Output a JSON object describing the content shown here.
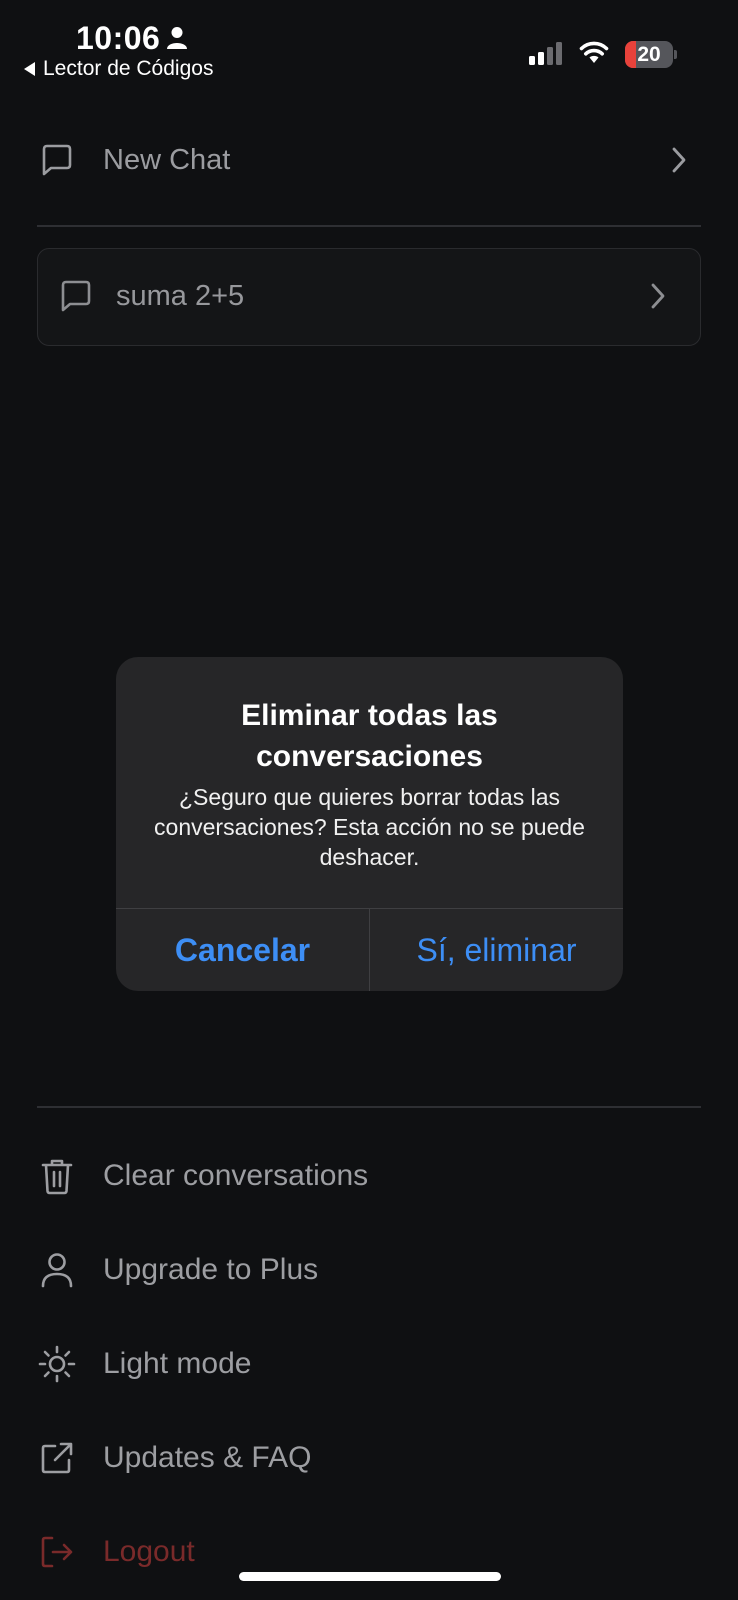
{
  "status_bar": {
    "time": "10:06",
    "back_label": "Lector de Códigos",
    "battery_level": "20"
  },
  "sidebar": {
    "new_chat_label": "New Chat",
    "conversations": [
      {
        "title": "suma 2+5"
      }
    ],
    "menu": [
      {
        "label": "Clear conversations",
        "icon": "trash-icon"
      },
      {
        "label": "Upgrade to Plus",
        "icon": "user-icon"
      },
      {
        "label": "Light mode",
        "icon": "sun-icon"
      },
      {
        "label": "Updates & FAQ",
        "icon": "external-link-icon"
      },
      {
        "label": "Logout",
        "icon": "logout-icon"
      }
    ]
  },
  "alert": {
    "title": "Eliminar todas las conversaciones",
    "message": "¿Seguro que quieres borrar todas las conversaciones? Esta acción no se puede deshacer.",
    "cancel_label": "Cancelar",
    "confirm_label": "Sí, eliminar"
  },
  "colors": {
    "background": "#0f1012",
    "alert_button": "#3d8ef5",
    "logout": "#7a2a2a",
    "battery_low": "#e8423b"
  }
}
